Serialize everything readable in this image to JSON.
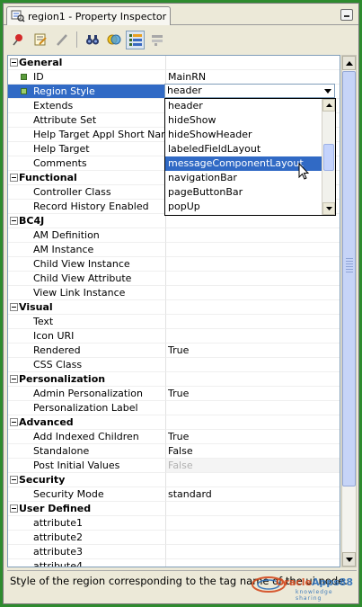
{
  "window": {
    "tab_title": "region1 - Property Inspector"
  },
  "toolbar": {
    "buttons": [
      {
        "name": "pin-icon"
      },
      {
        "name": "edit-properties-icon"
      },
      {
        "name": "pencil-icon"
      },
      {
        "name": "find-binoculars-icon"
      },
      {
        "name": "toggle-view-icon"
      },
      {
        "name": "categorized-view-icon"
      },
      {
        "name": "flat-view-icon"
      }
    ]
  },
  "sections": {
    "general": "General",
    "functional": "Functional",
    "bc4j": "BC4J",
    "visual": "Visual",
    "personalization": "Personalization",
    "advanced": "Advanced",
    "security": "Security",
    "user_defined": "User Defined"
  },
  "props": {
    "id": {
      "name": "ID",
      "value": "MainRN"
    },
    "region_style": {
      "name": "Region Style",
      "value": "header"
    },
    "extends": {
      "name": "Extends",
      "value": ""
    },
    "attribute_set": {
      "name": "Attribute Set",
      "value": ""
    },
    "help_target_appl": {
      "name": "Help Target Appl Short Name",
      "value": ""
    },
    "help_target": {
      "name": "Help Target",
      "value": ""
    },
    "comments": {
      "name": "Comments",
      "value": ""
    },
    "controller_class": {
      "name": "Controller Class",
      "value": ""
    },
    "record_history": {
      "name": "Record History Enabled",
      "value": ""
    },
    "am_definition": {
      "name": "AM Definition",
      "value": ""
    },
    "am_instance": {
      "name": "AM Instance",
      "value": ""
    },
    "child_view_instance": {
      "name": "Child View Instance",
      "value": ""
    },
    "child_view_attribute": {
      "name": "Child View Attribute",
      "value": ""
    },
    "view_link_instance": {
      "name": "View Link Instance",
      "value": ""
    },
    "text": {
      "name": "Text",
      "value": ""
    },
    "icon_uri": {
      "name": "Icon URI",
      "value": ""
    },
    "rendered": {
      "name": "Rendered",
      "value": "True"
    },
    "css_class": {
      "name": "CSS Class",
      "value": ""
    },
    "admin_personalization": {
      "name": "Admin Personalization",
      "value": "True"
    },
    "personalization_label": {
      "name": "Personalization Label",
      "value": ""
    },
    "add_indexed_children": {
      "name": "Add Indexed Children",
      "value": "True"
    },
    "standalone": {
      "name": "Standalone",
      "value": "False"
    },
    "post_initial_values": {
      "name": "Post Initial Values",
      "value": "False"
    },
    "security_mode": {
      "name": "Security Mode",
      "value": "standard"
    },
    "attribute1": {
      "name": "attribute1",
      "value": ""
    },
    "attribute2": {
      "name": "attribute2",
      "value": ""
    },
    "attribute3": {
      "name": "attribute3",
      "value": ""
    },
    "attribute4": {
      "name": "attribute4",
      "value": ""
    }
  },
  "dropdown": {
    "options": [
      "header",
      "hideShow",
      "hideShowHeader",
      "labeledFieldLayout",
      "messageComponentLayout",
      "navigationBar",
      "pageButtonBar",
      "popUp"
    ],
    "highlighted": "messageComponentLayout"
  },
  "description": "Style of the region corresponding to the tag name of the ui node.",
  "watermark": {
    "brand_a": "Oracle",
    "brand_b": "Apps88",
    "tagline": "knowledge sharing"
  },
  "colors": {
    "frame": "#2e8b2e",
    "selection": "#316ac5",
    "category_bullet": "#5a9c3c"
  }
}
